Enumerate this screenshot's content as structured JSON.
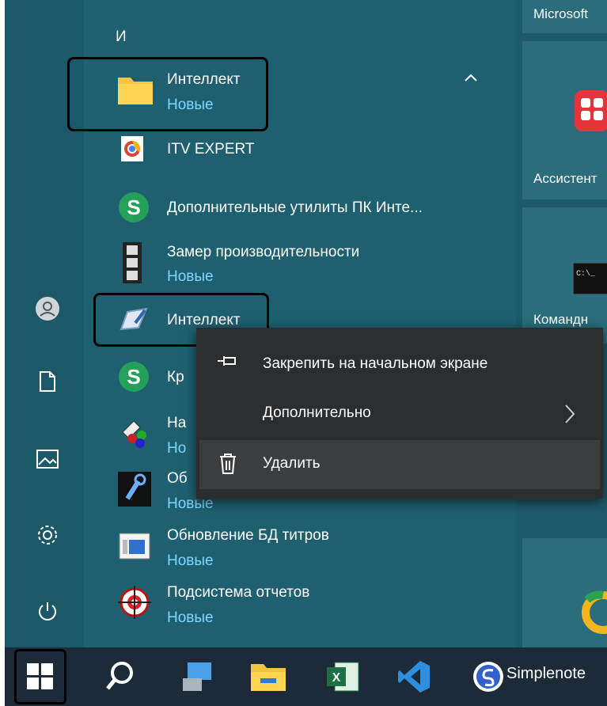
{
  "start_menu": {
    "section_letter": "И",
    "apps": [
      {
        "name": "Интеллект",
        "sub": "Новые",
        "icon": "folder-icon"
      },
      {
        "name": "ITV EXPERT",
        "icon": "chrome-icon"
      },
      {
        "name": "Дополнительные утилиты ПК Инте...",
        "icon": "s-icon"
      },
      {
        "name": "Замер производительности",
        "sub": "Новые",
        "icon": "film-icon"
      },
      {
        "name": "Интеллект",
        "icon": "intellect-icon"
      },
      {
        "name": "Кр",
        "icon": "s-icon"
      },
      {
        "name": "На",
        "sub": "Но",
        "icon": "gears-icon"
      },
      {
        "name": "Об",
        "sub": "Новые",
        "icon": "wrench-icon"
      },
      {
        "name": "Обновление БД титров",
        "sub": "Новые",
        "icon": "window-icon"
      },
      {
        "name": "Подсистема отчетов",
        "sub": "Новые",
        "icon": "target-icon"
      }
    ],
    "tiles": [
      "Microsoft",
      "Ассистент",
      "Командн"
    ]
  },
  "context_menu": {
    "items": [
      {
        "label": "Закрепить на начальном экране",
        "icon": "pin-icon"
      },
      {
        "label": "Дополнительно",
        "icon": "chevron-right-icon"
      },
      {
        "label": "Удалить",
        "icon": "trash-icon"
      }
    ]
  },
  "taskbar": {
    "app_label": "Simplenote",
    "icons": [
      "windows-icon",
      "search-icon",
      "computer-icon",
      "file-explorer-icon",
      "excel-icon",
      "vscode-icon",
      "simplenote-icon"
    ]
  },
  "colors": {
    "start_bg": "#1f6070",
    "new_label": "#7fd4ff",
    "context_bg": "#2b2d2f",
    "taskbar_bg": "#1d2b39"
  }
}
